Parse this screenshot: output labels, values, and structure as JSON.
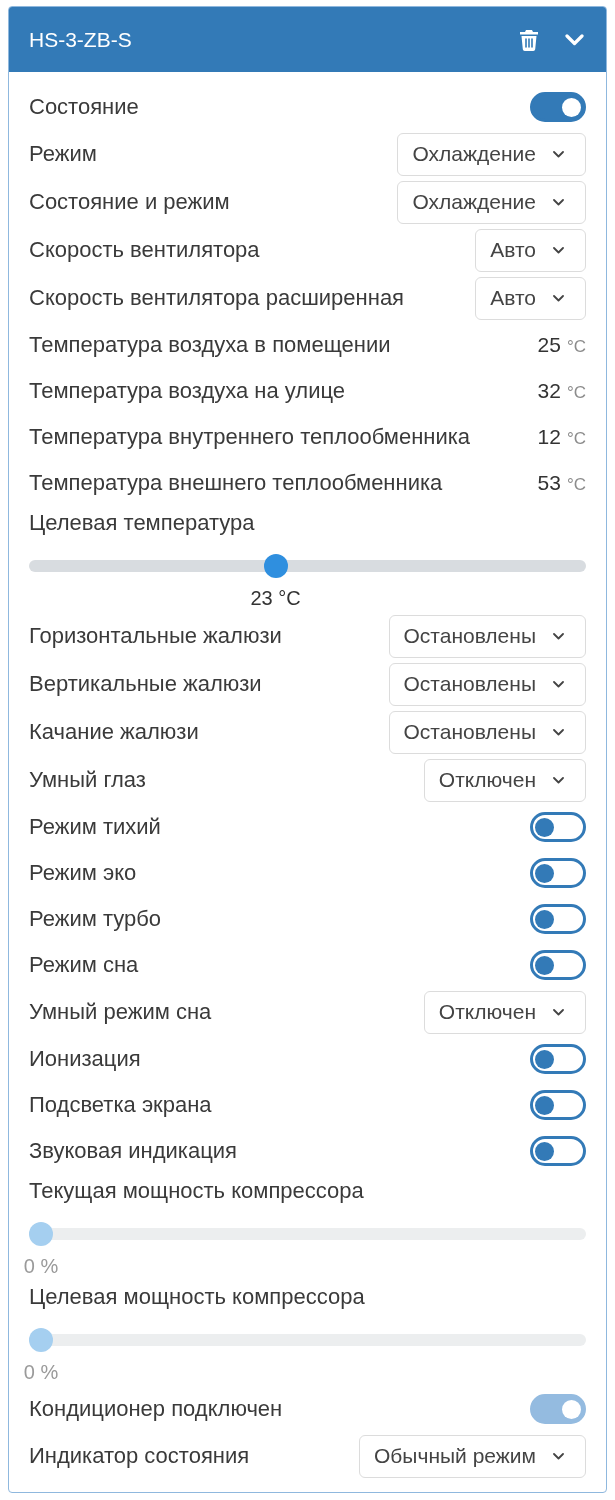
{
  "panel": {
    "title": "HS-3-ZB-S"
  },
  "rows": [
    {
      "kind": "toggle",
      "label": "Состояние",
      "on": true,
      "disabled": false
    },
    {
      "kind": "select",
      "label": "Режим",
      "value": "Охлаждение"
    },
    {
      "kind": "select",
      "label": "Состояние и режим",
      "value": "Охлаждение"
    },
    {
      "kind": "select",
      "label": "Скорость вентилятора",
      "value": "Авто"
    },
    {
      "kind": "select",
      "label": "Скорость вентилятора расширенная",
      "value": "Авто"
    },
    {
      "kind": "reading",
      "label": "Температура воздуха в помещении",
      "value": "25",
      "unit": "°C"
    },
    {
      "kind": "reading",
      "label": "Температура воздуха на улице",
      "value": "32",
      "unit": "°C"
    },
    {
      "kind": "reading",
      "label": "Температура внутреннего теплообменника",
      "value": "12",
      "unit": "°C"
    },
    {
      "kind": "reading",
      "label": "Температура внешнего теплообменника",
      "value": "53",
      "unit": "°C"
    },
    {
      "kind": "slider",
      "label": "Целевая температура",
      "level": 0.44,
      "reading": "23 °C",
      "disabled": false
    },
    {
      "kind": "select",
      "label": "Горизонтальные жалюзи",
      "value": "Остановлены"
    },
    {
      "kind": "select",
      "label": "Вертикальные жалюзи",
      "value": "Остановлены"
    },
    {
      "kind": "select",
      "label": "Качание жалюзи",
      "value": "Остановлены"
    },
    {
      "kind": "select",
      "label": "Умный глаз",
      "value": "Отключен"
    },
    {
      "kind": "toggle",
      "label": "Режим тихий",
      "on": false,
      "disabled": false
    },
    {
      "kind": "toggle",
      "label": "Режим эко",
      "on": false,
      "disabled": false
    },
    {
      "kind": "toggle",
      "label": "Режим турбо",
      "on": false,
      "disabled": false
    },
    {
      "kind": "toggle",
      "label": "Режим сна",
      "on": false,
      "disabled": false
    },
    {
      "kind": "select",
      "label": "Умный режим сна",
      "value": "Отключен"
    },
    {
      "kind": "toggle",
      "label": "Ионизация",
      "on": false,
      "disabled": false
    },
    {
      "kind": "toggle",
      "label": "Подсветка экрана",
      "on": false,
      "disabled": false
    },
    {
      "kind": "toggle",
      "label": "Звуковая индикация",
      "on": false,
      "disabled": false
    },
    {
      "kind": "slider",
      "label": "Текущая мощность компрессора",
      "level": 0,
      "reading": "0 %",
      "disabled": true
    },
    {
      "kind": "slider",
      "label": "Целевая мощность компрессора",
      "level": 0,
      "reading": "0 %",
      "disabled": true
    },
    {
      "kind": "toggle",
      "label": "Кондиционер подключен",
      "on": true,
      "disabled": true
    },
    {
      "kind": "select",
      "label": "Индикатор состояния",
      "value": "Обычный режим"
    }
  ]
}
